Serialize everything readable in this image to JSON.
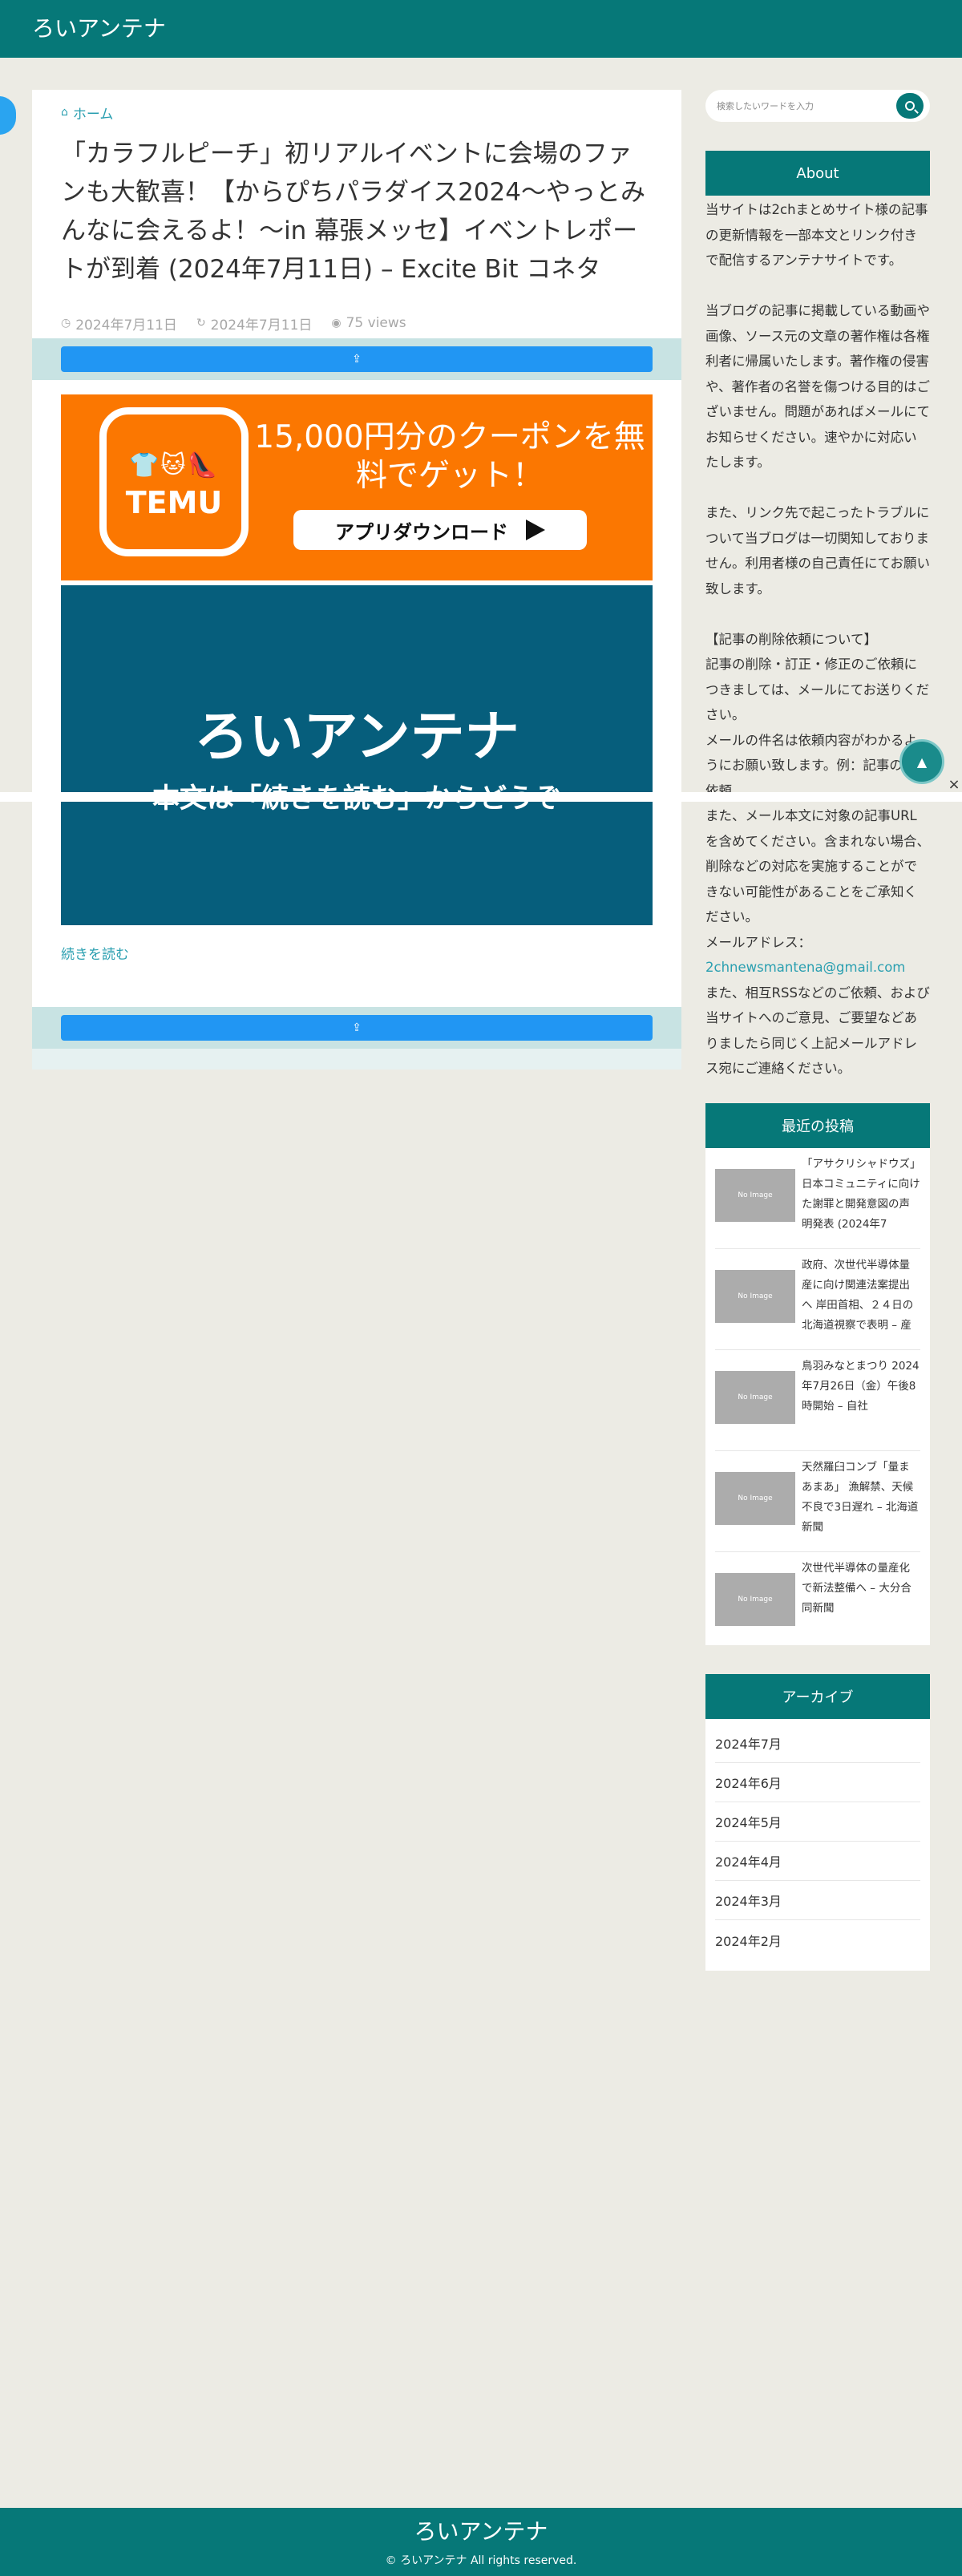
{
  "header": {
    "site_title": "ろいアンテナ"
  },
  "article": {
    "breadcrumb_icon": "home-icon",
    "breadcrumb": "ホーム",
    "title": "「カラフルピーチ」初リアルイベントに会場のファンも大歓喜！【からぴちパラダイス2024〜やっとみんなに会えるよ！〜in 幕張メッセ】イベントレポートが到着 (2024年7月11日) – Excite Bit コネタ",
    "published": "2024年7月11日",
    "updated": "2024年7月11日",
    "views": "75 views",
    "share_icon": "share-icon",
    "share_label": "",
    "temu_banner": {
      "logo_text": "TEMU",
      "logo_icons": "👕🐱👠",
      "headline": "15,000円分のクーポンを無料でゲット！",
      "download_label": "アプリダウンロード"
    },
    "antenna_banner": {
      "title": "ろいアンテナ",
      "subtitle": "本文は「続きを読む」からどうぞ"
    },
    "read_more": "続きを読む"
  },
  "sidebar": {
    "search_placeholder": "検索したいワードを入力",
    "about": {
      "heading": "About",
      "paragraphs": [
        "当サイトは2chまとめサイト様の記事の更新情報を一部本文とリンク付きで配信するアンテナサイトです。",
        "当ブログの記事に掲載している動画や画像、ソース元の文章の著作権は各権利者に帰属いたします。著作権の侵害や、著作者の名誉を傷つける目的はございません。問題があればメールにてお知らせください。速やかに対応いたします。",
        "また、リンク先で起こったトラブルについて当ブログは一切関知しておりません。利用者様の自己責任にてお願い致します。",
        "【記事の削除依頼について】",
        "記事の削除・訂正・修正のご依頼につきましては、メールにてお送りください。",
        "メールの件名は依頼内容がわかるようにお願い致します。例：記事の削除依頼",
        "また、メール本文に対象の記事URLを含めてください。含まれない場合、削除などの対応を実施することができない可能性があることをご承知ください。",
        "メールアドレス：",
        "2chnewsmantena@gmail.com",
        "また、相互RSSなどのご依頼、および当サイトへのご意見、ご要望などありましたら同じく上記メールアドレス宛にご連絡ください。"
      ]
    },
    "recent": {
      "heading": "最近の投稿",
      "items": [
        {
          "title": "「アサクリシャドウズ」日本コミュニティに向けた謝罪と開発意図の声明発表 (2024年7",
          "thumb": "No Image"
        },
        {
          "title": "政府、次世代半導体量産に向け関連法案提出へ 岸田首相、２４日の北海道視察で表明 – 産",
          "thumb": "No Image"
        },
        {
          "title": "鳥羽みなとまつり 2024年7月26日（金）午後8時開始 – 自社",
          "thumb": "No Image"
        },
        {
          "title": "天然羅臼コンブ「量まあまあ」 漁解禁、天候不良で3日遅れ – 北海道新聞",
          "thumb": "No Image"
        },
        {
          "title": "次世代半導体の量産化で新法整備へ – 大分合同新聞",
          "thumb": "No Image"
        }
      ]
    },
    "archive": {
      "heading": "アーカイブ",
      "items": [
        "2024年7月",
        "2024年6月",
        "2024年5月",
        "2024年4月",
        "2024年3月",
        "2024年2月"
      ]
    }
  },
  "footer": {
    "title": "ろいアンテナ",
    "copyright": "© ろいアンテナ All rights reserved."
  },
  "colors": {
    "brand": "#067878",
    "background": "#ecebe4",
    "link": "#2a9fb0",
    "share_button": "#2196f3",
    "temu_orange": "#fb7701",
    "antenna_blue": "#065e7c"
  },
  "floating": {
    "close_label": "×",
    "circle_icon": "scroll-top-icon"
  }
}
